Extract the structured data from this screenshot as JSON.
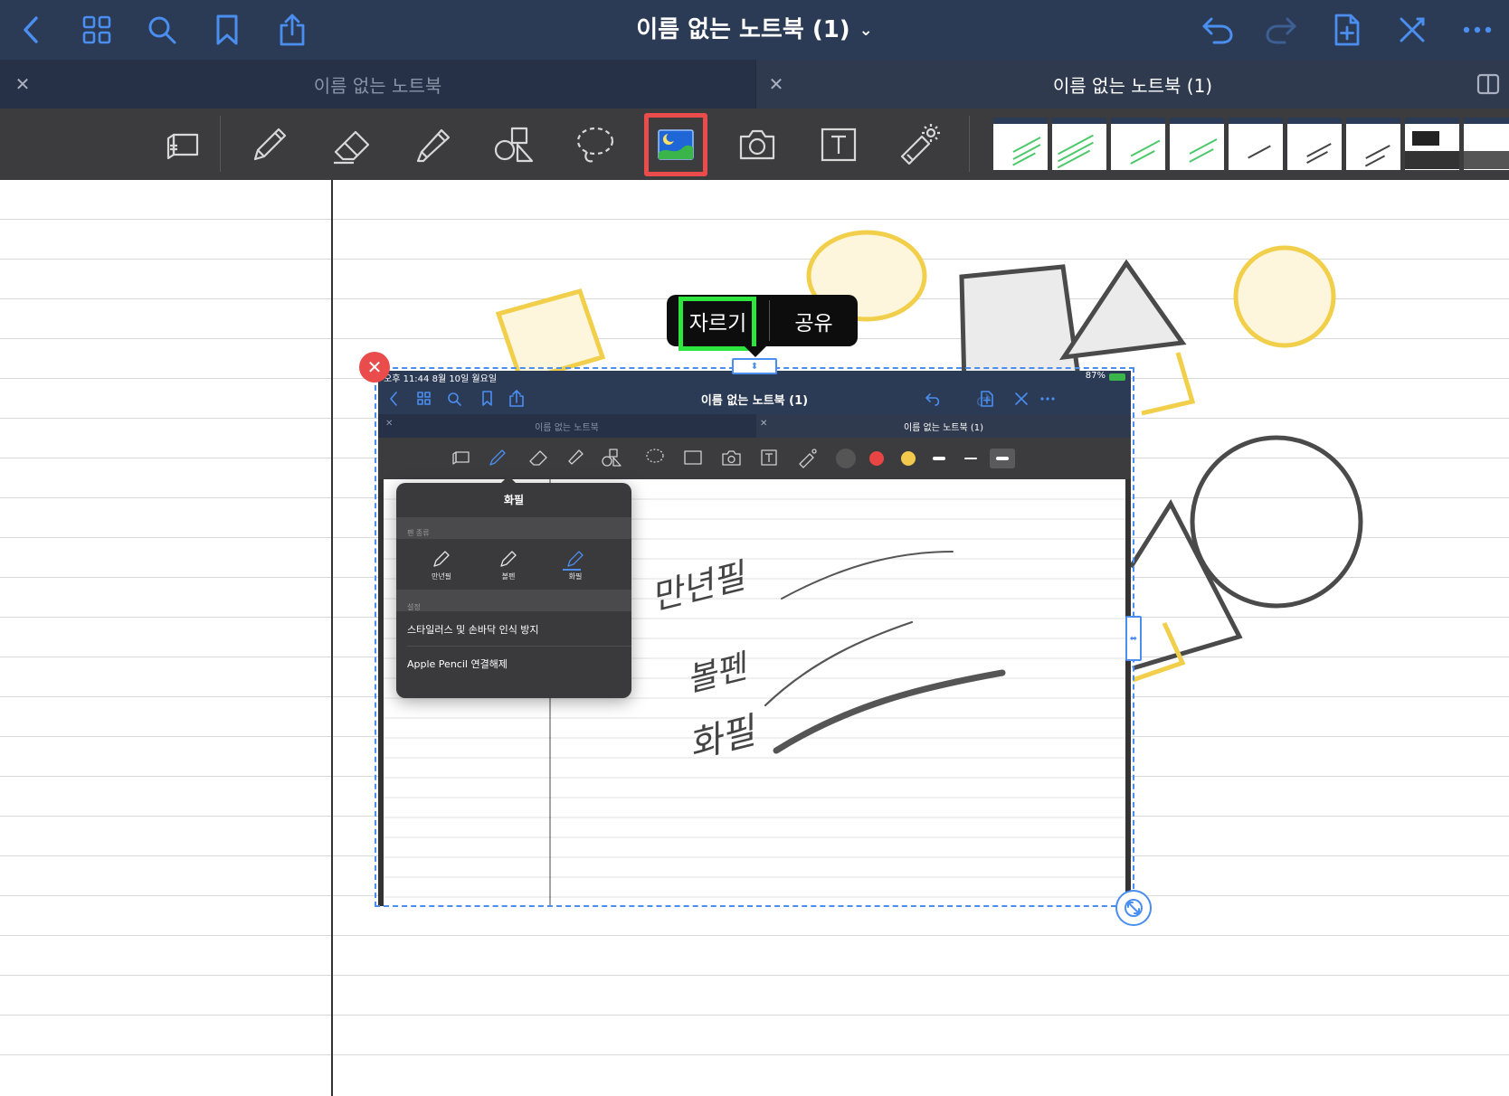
{
  "navbar": {
    "title": "이름 없는 노트북 (1)",
    "icons": [
      "back-icon",
      "grid-icon",
      "search-icon",
      "bookmark-icon",
      "share-icon",
      "undo-icon",
      "redo-icon",
      "add-page-icon",
      "close-pen-icon",
      "more-icon"
    ]
  },
  "tabs": {
    "left_label": "이름 없는 노트북",
    "right_label": "이름 없는 노트북 (1)"
  },
  "toolbar": {
    "tools": [
      "read-only-icon",
      "pen-icon",
      "eraser-icon",
      "highlighter-icon",
      "shapes-icon",
      "lasso-icon",
      "image-icon",
      "camera-icon",
      "text-icon",
      "laser-pointer-icon"
    ],
    "selected_tool": "image-icon"
  },
  "context_menu": {
    "cut": "자르기",
    "share": "공유"
  },
  "screenshot": {
    "status_time": "오후 11:44  8월 10일 월요일",
    "status_battery": "87%",
    "nav_title": "이름 없는 노트북 (1)",
    "tab_left": "이름 없는 노트북",
    "tab_right": "이름 없는 노트북 (1)",
    "popover": {
      "title": "화필",
      "section_pen_type": "펜 종류",
      "pen_fountain": "만년필",
      "pen_ball": "볼펜",
      "pen_brush": "화필",
      "section_settings": "설정",
      "setting_stylus": "스타일러스 및 손바닥 인식 방지",
      "setting_disconnect": "Apple Pencil 연결해제"
    },
    "handwriting": [
      "만년필",
      "볼펜",
      "화필"
    ]
  },
  "colors": {
    "nav_bg": "#2b3a55",
    "accent_blue": "#4a8ef0",
    "toolbar_bg": "#3c3c3e",
    "highlight_red": "#ea4b4b",
    "highlight_green": "#2ee53f",
    "shape_yellow": "#f2cf4a",
    "shape_gray": "#4a4a4a"
  }
}
